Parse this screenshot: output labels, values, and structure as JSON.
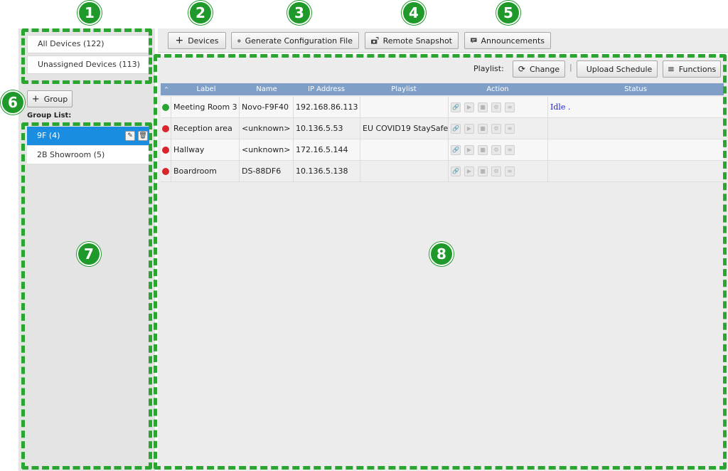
{
  "callouts": [
    "1",
    "2",
    "3",
    "4",
    "5",
    "6",
    "7",
    "8"
  ],
  "devices_panel": {
    "all_devices": "All Devices (122)",
    "unassigned_devices": "Unassigned Devices (113)"
  },
  "groups": {
    "add_group_label": "Group",
    "list_label": "Group List:",
    "items": [
      {
        "label": "9F (4)",
        "selected": true
      },
      {
        "label": "2B Showroom (5)",
        "selected": false
      }
    ]
  },
  "toolbar": {
    "add_devices": "Devices",
    "generate_config": "Generate Configuration File",
    "remote_snapshot": "Remote Snapshot",
    "announcements": "Announcements"
  },
  "playlist_bar": {
    "label": "Playlist:",
    "change": "Change",
    "upload_schedule": "Upload Schedule",
    "functions": "Functions"
  },
  "table": {
    "columns": [
      "Label",
      "Name",
      "IP Address",
      "Playlist",
      "Action",
      "Status"
    ],
    "rows": [
      {
        "status_color": "#2aa52f",
        "label": "Meeting Room 3",
        "name": "Novo-F9F40",
        "ip": "192.168.86.113",
        "playlist": "",
        "status": "Idle ."
      },
      {
        "status_color": "#d9262b",
        "label": "Reception area",
        "name": "<unknown>",
        "ip": "10.136.5.53",
        "playlist": "EU COVID19 StaySafe",
        "status": ""
      },
      {
        "status_color": "#d9262b",
        "label": "Hallway",
        "name": "<unknown>",
        "ip": "172.16.5.144",
        "playlist": "",
        "status": ""
      },
      {
        "status_color": "#d9262b",
        "label": "Boardroom",
        "name": "DS-88DF6",
        "ip": "10.136.5.138",
        "playlist": "",
        "status": ""
      }
    ]
  },
  "colors": {
    "highlight": "#2aa52f",
    "selected_group": "#1a8de0",
    "table_header": "#7f9fc6",
    "status_idle_text": "#1a1ae0"
  }
}
